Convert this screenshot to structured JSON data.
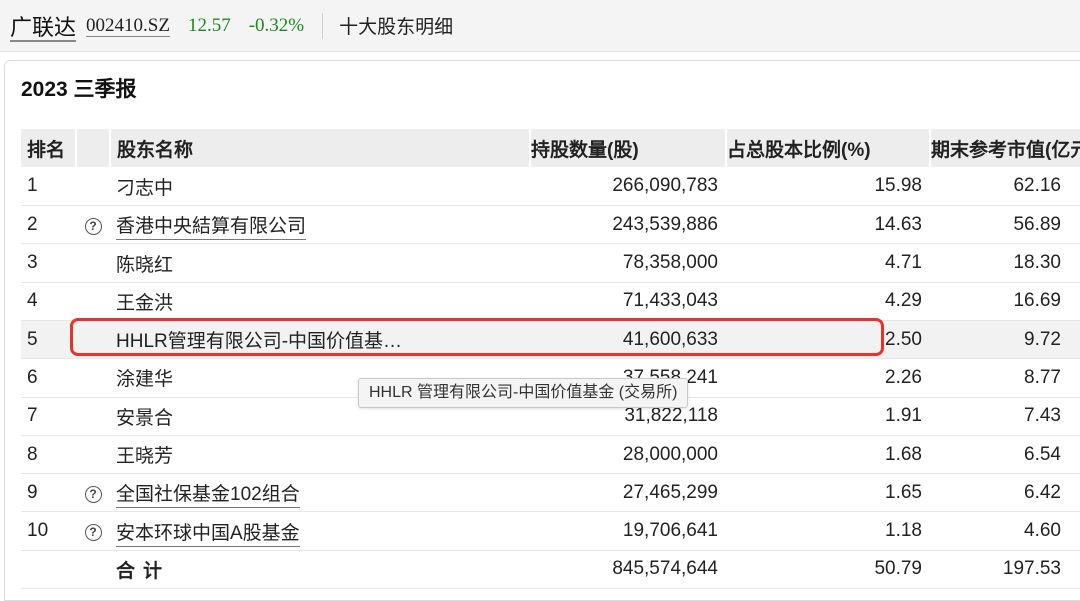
{
  "header": {
    "stock_name": "广联达",
    "stock_code": "002410.SZ",
    "price": "12.57",
    "change": "-0.32%",
    "page_title": "十大股东明细"
  },
  "report": {
    "title": "2023 三季报"
  },
  "table": {
    "columns": [
      "排名",
      "股东名称",
      "持股数量(股)",
      "占总股本比例(%)",
      "期末参考市值(亿元)"
    ],
    "help_icon": "?",
    "rows": [
      {
        "rank": "1",
        "has_help": false,
        "name": "刁志中",
        "shares": "266,090,783",
        "ratio": "15.98",
        "value": "62.16"
      },
      {
        "rank": "2",
        "has_help": true,
        "name": "香港中央結算有限公司",
        "shares": "243,539,886",
        "ratio": "14.63",
        "value": "56.89"
      },
      {
        "rank": "3",
        "has_help": false,
        "name": "陈晓红",
        "shares": "78,358,000",
        "ratio": "4.71",
        "value": "18.30"
      },
      {
        "rank": "4",
        "has_help": false,
        "name": "王金洪",
        "shares": "71,433,043",
        "ratio": "4.29",
        "value": "16.69"
      },
      {
        "rank": "5",
        "has_help": false,
        "name": "HHLR管理有限公司-中国价值基…",
        "shares": "41,600,633",
        "ratio": "2.50",
        "value": "9.72"
      },
      {
        "rank": "6",
        "has_help": false,
        "name": "涂建华",
        "shares": "37,558,241",
        "ratio": "2.26",
        "value": "8.77"
      },
      {
        "rank": "7",
        "has_help": false,
        "name": "安景合",
        "shares": "31,822,118",
        "ratio": "1.91",
        "value": "7.43"
      },
      {
        "rank": "8",
        "has_help": false,
        "name": "王晓芳",
        "shares": "28,000,000",
        "ratio": "1.68",
        "value": "6.54"
      },
      {
        "rank": "9",
        "has_help": true,
        "name": "全国社保基金102组合",
        "shares": "27,465,299",
        "ratio": "1.65",
        "value": "6.42"
      },
      {
        "rank": "10",
        "has_help": true,
        "name": "安本环球中国A股基金",
        "shares": "19,706,641",
        "ratio": "1.18",
        "value": "4.60"
      }
    ],
    "total": {
      "label": "合计",
      "shares": "845,574,644",
      "ratio": "50.79",
      "value": "197.53"
    }
  },
  "tooltip": {
    "text": "HHLR 管理有限公司-中国价值基金 (交易所)"
  },
  "colors": {
    "price_change": "#1a8a1a",
    "highlight_border": "#e8322a",
    "header_bg": "#ededed"
  }
}
